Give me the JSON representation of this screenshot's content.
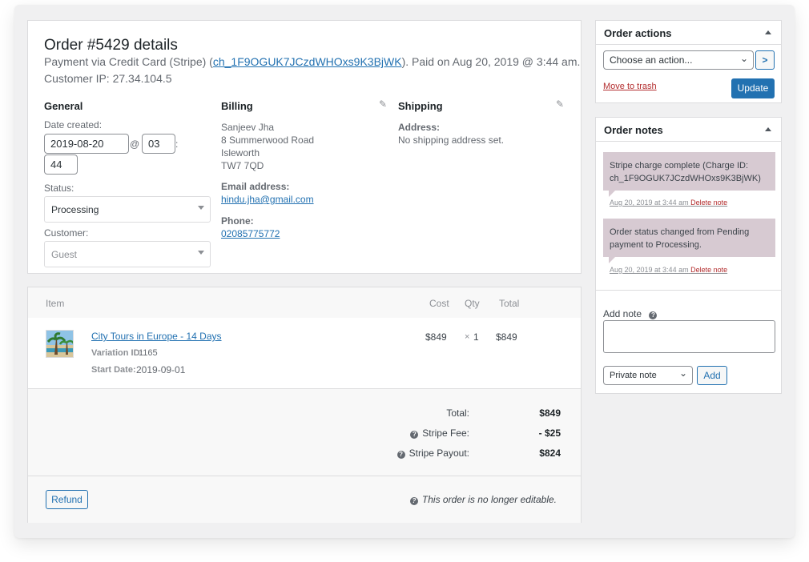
{
  "order": {
    "title": "Order #5429 details",
    "payment_prefix": "Payment via Credit Card (Stripe) (",
    "charge_id": "ch_1F9OGUK7JCzdWHOxs9K3BjWK",
    "payment_suffix": "). Paid on Aug 20, 2019 @ 3:44 am.",
    "customer_ip": "Customer IP: 27.34.104.5"
  },
  "general": {
    "heading": "General",
    "date_label": "Date created:",
    "date_value": "2019-08-20",
    "at_sign": "@",
    "hour": "03",
    "colon": ":",
    "minute": "44",
    "status_label": "Status:",
    "status_value": "Processing",
    "customer_label": "Customer:",
    "customer_value": "Guest"
  },
  "billing": {
    "heading": "Billing",
    "address_lines": [
      "Sanjeev Jha",
      "8 Summerwood Road",
      "Isleworth",
      "TW7 7QD"
    ],
    "email_label": "Email address:",
    "email": "hindu.jha@gmail.com",
    "phone_label": "Phone:",
    "phone": "02085775772"
  },
  "shipping": {
    "heading": "Shipping",
    "address_label": "Address:",
    "address_value": "No shipping address set."
  },
  "items": {
    "headers": {
      "item": "Item",
      "cost": "Cost",
      "qty": "Qty",
      "total": "Total"
    },
    "rows": [
      {
        "name": "City Tours in Europe - 14 Days",
        "variation_label": "Variation ID:",
        "variation_id": "1165",
        "start_label": "Start Date:",
        "start_date": "2019-09-01",
        "cost": "$849",
        "qty_prefix": "×",
        "qty": "1",
        "total": "$849"
      }
    ],
    "totals": {
      "total_label": "Total:",
      "total_value": "$849",
      "fee_label": "Stripe Fee:",
      "fee_value": "- $25",
      "payout_label": "Stripe Payout:",
      "payout_value": "$824"
    },
    "refund_label": "Refund",
    "not_editable": "This order is no longer editable."
  },
  "order_actions": {
    "title": "Order actions",
    "select_value": "Choose an action...",
    "go_glyph": ">",
    "trash_label": "Move to trash",
    "update_label": "Update"
  },
  "order_notes": {
    "title": "Order notes",
    "notes": [
      {
        "text": "Stripe charge complete (Charge ID: ch_1F9OGUK7JCzdWHOxs9K3BjWK)",
        "meta": "Aug 20, 2019 at 3:44 am",
        "delete": "Delete note"
      },
      {
        "text": "Order status changed from Pending payment to Processing.",
        "meta": "Aug 20, 2019 at 3:44 am",
        "delete": "Delete note"
      }
    ],
    "add_note_label": "Add note",
    "note_type": "Private note",
    "add_button": "Add"
  },
  "icons": {
    "help": "question-circle-icon",
    "edit": "pencil-icon",
    "collapse": "triangle-up-icon",
    "dropdown": "chevron-down-icon"
  }
}
